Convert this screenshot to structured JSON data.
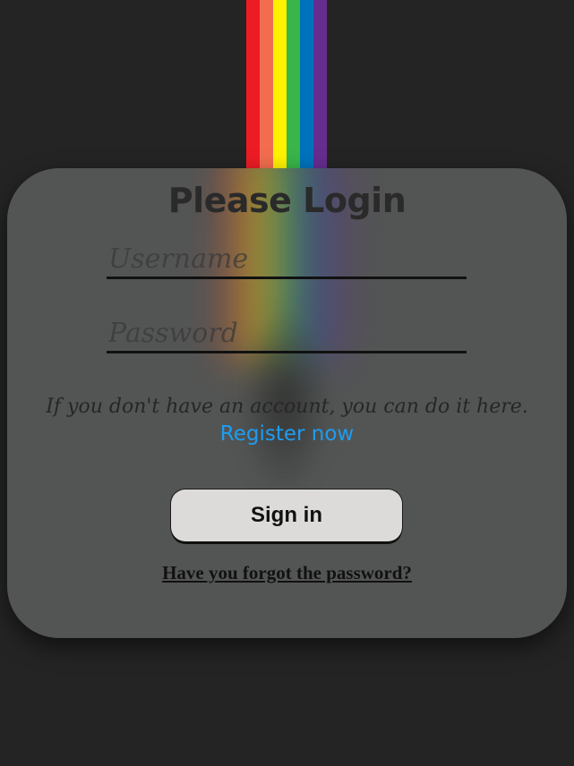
{
  "colors": {
    "page_bg": "#242424",
    "card_bg": "#535554",
    "link": "#1f9cf0",
    "button_bg": "#dcdbda",
    "rainbow": [
      "#ed1c24",
      "#f26d4f",
      "#fff200",
      "#39b54a",
      "#0072bc",
      "#662d91"
    ]
  },
  "login": {
    "title": "Please Login",
    "username_placeholder": "Username",
    "password_placeholder": "Password",
    "info_text": "If you don't have an account, you can do it here.",
    "register_link": "Register now",
    "signin_label": "Sign in",
    "forgot_link": "Have you forgot the password?"
  }
}
